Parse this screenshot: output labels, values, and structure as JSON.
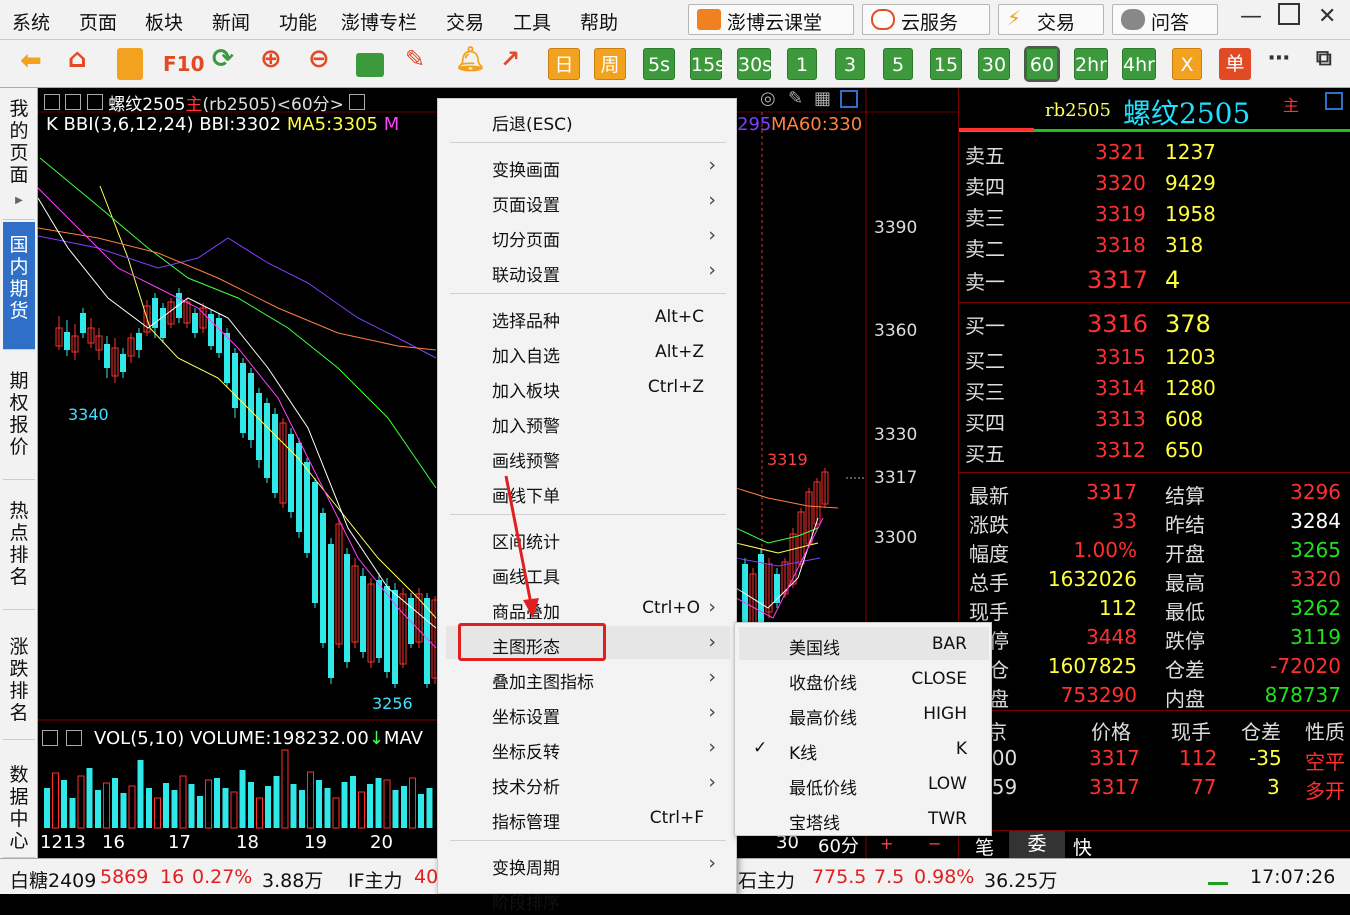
{
  "menubar": {
    "items": [
      "系统",
      "页面",
      "板块",
      "新闻",
      "功能",
      "澎博专栏",
      "交易",
      "工具",
      "帮助"
    ],
    "right_buttons": [
      "澎博云课堂",
      "云服务",
      "交易",
      "问答"
    ]
  },
  "toolbar": {
    "text_buttons": [
      "F10",
      "日",
      "周",
      "5s",
      "15s",
      "30s",
      "1",
      "3",
      "5",
      "15",
      "30",
      "60",
      "2hr",
      "4hr",
      "X",
      "单"
    ],
    "selected": "60",
    "icons": [
      "back-arrow-icon",
      "home-icon",
      "note-icon",
      "refresh-icon",
      "zoom-in-icon",
      "zoom-out-icon",
      "window-icon",
      "pencil-icon",
      "bell-icon",
      "trend-icon",
      "more-icon",
      "fullscreen-icon"
    ]
  },
  "sidebar": {
    "tabs": [
      "我的页面",
      "国内期货",
      "期权报价",
      "热点排名",
      "涨跌排名",
      "数据中心"
    ],
    "active": "国内期货"
  },
  "chart": {
    "title": "螺纹2505",
    "title_main": "主",
    "code": "(rb2505)",
    "period": "<60分>",
    "indicator": {
      "k": "K",
      "bbi": "BBI(3,6,12,24) BBI:3302",
      "ma5": "MA5:3305",
      "ma_cut": "M",
      "ma_tail": "295",
      "ma60": "MA60:330"
    },
    "price_labels": {
      "p3390": "3390",
      "p3360": "3360",
      "p3330": "3330",
      "p3317": "3317",
      "p3300": "3300"
    },
    "annotations": {
      "low_left": "3340",
      "low_bottom": "3256",
      "high_right": "3319"
    },
    "volume_line": "VOL(5,10) VOLUME:198232.00",
    "volume_tail": "MAV",
    "x_labels": [
      "1213",
      "16",
      "17",
      "18",
      "19",
      "20"
    ],
    "bottom_right": {
      "n": "30",
      "period": "60分"
    }
  },
  "quote": {
    "code": "rb2505",
    "name": "螺纹2505",
    "main": "主",
    "asks": [
      {
        "label": "卖五",
        "price": "3321",
        "vol": "1237"
      },
      {
        "label": "卖四",
        "price": "3320",
        "vol": "9429"
      },
      {
        "label": "卖三",
        "price": "3319",
        "vol": "1958"
      },
      {
        "label": "卖二",
        "price": "3318",
        "vol": "318"
      },
      {
        "label": "卖一",
        "price": "3317",
        "vol": "4"
      }
    ],
    "bids": [
      {
        "label": "买一",
        "price": "3316",
        "vol": "378"
      },
      {
        "label": "买二",
        "price": "3315",
        "vol": "1203"
      },
      {
        "label": "买三",
        "price": "3314",
        "vol": "1280"
      },
      {
        "label": "买四",
        "price": "3313",
        "vol": "608"
      },
      {
        "label": "买五",
        "price": "3312",
        "vol": "650"
      }
    ],
    "stats": [
      {
        "l1": "最新",
        "v1": "3317",
        "l2": "结算",
        "v2": "3296"
      },
      {
        "l1": "涨跌",
        "v1": "33",
        "l2": "昨结",
        "v2": "3284"
      },
      {
        "l1": "幅度",
        "v1": "1.00%",
        "l2": "开盘",
        "v2": "3265"
      },
      {
        "l1": "总手",
        "v1": "1632026",
        "l2": "最高",
        "v2": "3320"
      },
      {
        "l1": "现手",
        "v1": "112",
        "l2": "最低",
        "v2": "3262"
      },
      {
        "l1": "停",
        "v1": "3448",
        "l2": "跌停",
        "v2": "3119"
      },
      {
        "l1": "仓",
        "v1": "1607825",
        "l2": "仓差",
        "v2": "-72020"
      },
      {
        "l1": "盘",
        "v1": "753290",
        "l2": "内盘",
        "v2": "878737"
      }
    ],
    "trade_header": [
      "京",
      "价格",
      "现手",
      "仓差",
      "性质"
    ],
    "trades": [
      {
        "t": ":00",
        "p": "3317",
        "v": "112",
        "d": "-35",
        "n": "空平"
      },
      {
        "t": ":59",
        "p": "3317",
        "v": "77",
        "d": "3",
        "n": "多开"
      }
    ],
    "bottom_tabs": [
      "笔",
      "委",
      "快"
    ]
  },
  "context_menu": {
    "items": [
      {
        "label": "后退(ESC)"
      },
      {
        "label": "变换画面",
        "sub": true
      },
      {
        "label": "页面设置",
        "sub": true
      },
      {
        "label": "切分页面",
        "sub": true
      },
      {
        "label": "联动设置",
        "sub": true
      },
      {
        "label": "选择品种",
        "key": "Alt+C"
      },
      {
        "label": "加入自选",
        "key": "Alt+Z"
      },
      {
        "label": "加入板块",
        "key": "Ctrl+Z"
      },
      {
        "label": "加入预警"
      },
      {
        "label": "画线预警"
      },
      {
        "label": "画线下单"
      },
      {
        "label": "区间统计"
      },
      {
        "label": "画线工具"
      },
      {
        "label": "商品叠加",
        "key": "Ctrl+O",
        "sub": true
      },
      {
        "label": "主图形态",
        "sub": true
      },
      {
        "label": "叠加主图指标",
        "sub": true
      },
      {
        "label": "坐标设置",
        "sub": true
      },
      {
        "label": "坐标反转",
        "sub": true
      },
      {
        "label": "技术分析",
        "sub": true
      },
      {
        "label": "指标管理",
        "key": "Ctrl+F"
      },
      {
        "label": "变换周期",
        "sub": true
      },
      {
        "label": "阶段排序"
      }
    ]
  },
  "sub_menu": {
    "items": [
      {
        "label": "美国线",
        "key": "BAR"
      },
      {
        "label": "收盘价线",
        "key": "CLOSE"
      },
      {
        "label": "最高价线",
        "key": "HIGH"
      },
      {
        "label": "K线",
        "key": "K",
        "checked": true
      },
      {
        "label": "最低价线",
        "key": "LOW"
      },
      {
        "label": "宝塔线",
        "key": "TWR"
      }
    ]
  },
  "statusbar": {
    "s1_name": "白糖2409",
    "s1_price": "5869",
    "s1_chg": "16",
    "s1_pct": "0.27%",
    "s1_vol": "3.88万",
    "s2_name": "IF主力",
    "s2_price": "40",
    "s3_name": "石主力",
    "s3_price": "775.5",
    "s3_chg": "7.5",
    "s3_pct": "0.98%",
    "s3_vol": "36.25万",
    "time": "17:07:26"
  },
  "colors": {
    "up": "#ff3030",
    "down": "#00ffff",
    "yellow": "#ffff40",
    "green": "#00c000",
    "accent": "#2f6fc8"
  }
}
